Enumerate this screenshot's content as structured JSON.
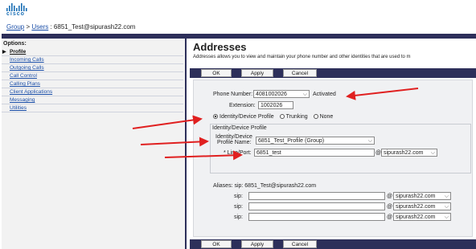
{
  "header": {
    "logo_text": "cisco",
    "breadcrumb": {
      "group": "Group",
      "sep1": " > ",
      "users": "Users",
      "sep2": " : ",
      "user": "6851_Test@sipurash22.com"
    }
  },
  "sidebar": {
    "title": "Options:",
    "items": [
      {
        "label": "Profile",
        "active": true
      },
      {
        "label": "Incoming Calls"
      },
      {
        "label": "Outgoing Calls"
      },
      {
        "label": "Call Control"
      },
      {
        "label": "Calling Plans"
      },
      {
        "label": "Client Applications"
      },
      {
        "label": "Messaging"
      },
      {
        "label": "Utilities"
      }
    ]
  },
  "main": {
    "title": "Addresses",
    "description": "Addresses allows you to view and maintain your phone number and other identities that are used to m",
    "buttons": {
      "ok": "OK",
      "apply": "Apply",
      "cancel": "Cancel"
    },
    "phone_number_label": "Phone Number:",
    "phone_number_value": "4081002026",
    "phone_status": "Activated",
    "extension_label": "Extension:",
    "extension_value": "1002026",
    "radios": {
      "identity": "Identity/Device Profile",
      "trunking": "Trunking",
      "none": "None",
      "selected": "identity"
    },
    "group_legend": "Identity/Device Profile",
    "profile_name_label_1": "Identity/Device",
    "profile_name_label_2": "Profile Name:",
    "profile_name_value": "6851_Test_Profile (Group)",
    "line_port_label": "* Line/Port:",
    "line_port_value": "6851_test",
    "at": "@",
    "domain": "sipurash22.com",
    "aliases_label": "Aliases: sip: 6851_Test@sipurash22.com",
    "sip_label": "sip:",
    "alias_rows": [
      {
        "value": "",
        "domain": "sipurash22.com"
      },
      {
        "value": "",
        "domain": "sipurash22.com"
      },
      {
        "value": "",
        "domain": "sipurash22.com"
      }
    ]
  },
  "colors": {
    "bar": "#2d2f5a",
    "arrow": "#e02020",
    "link": "#1a4ea8"
  }
}
